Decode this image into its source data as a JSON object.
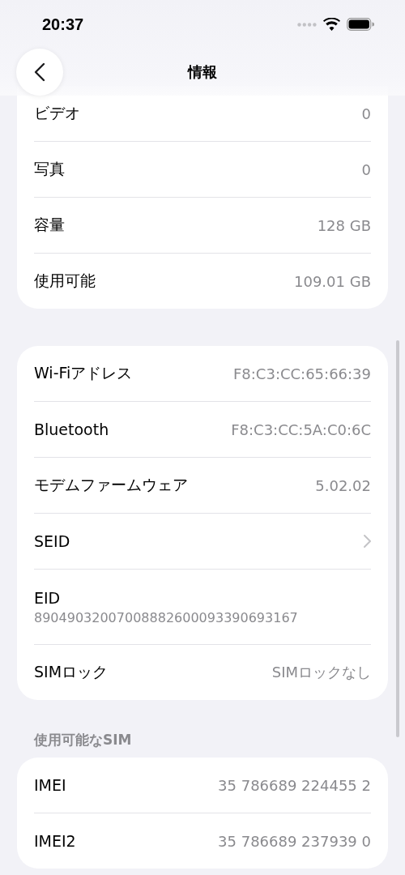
{
  "status_bar": {
    "time": "20:37"
  },
  "nav": {
    "title": "情報"
  },
  "sections": [
    {
      "rows": [
        {
          "label": "ビデオ",
          "value": "0",
          "kind": "value"
        },
        {
          "label": "写真",
          "value": "0",
          "kind": "value"
        },
        {
          "label": "容量",
          "value": "128 GB",
          "kind": "value"
        },
        {
          "label": "使用可能",
          "value": "109.01 GB",
          "kind": "value"
        }
      ]
    },
    {
      "rows": [
        {
          "label": "Wi-Fiアドレス",
          "value": "F8:C3:CC:65:66:39",
          "kind": "value"
        },
        {
          "label": "Bluetooth",
          "value": "F8:C3:CC:5A:C0:6C",
          "kind": "value"
        },
        {
          "label": "モデムファームウェア",
          "value": "5.02.02",
          "kind": "value"
        },
        {
          "label": "SEID",
          "kind": "link"
        },
        {
          "label": "EID",
          "value": "89049032007008882600093390693167",
          "kind": "stacked"
        },
        {
          "label": "SIMロック",
          "value": "SIMロックなし",
          "kind": "value"
        }
      ]
    },
    {
      "header": "使用可能なSIM",
      "rows": [
        {
          "label": "IMEI",
          "value": "35 786689 224455 2",
          "kind": "value"
        },
        {
          "label": "IMEI2",
          "value": "35 786689 237939 0",
          "kind": "value"
        }
      ]
    }
  ]
}
